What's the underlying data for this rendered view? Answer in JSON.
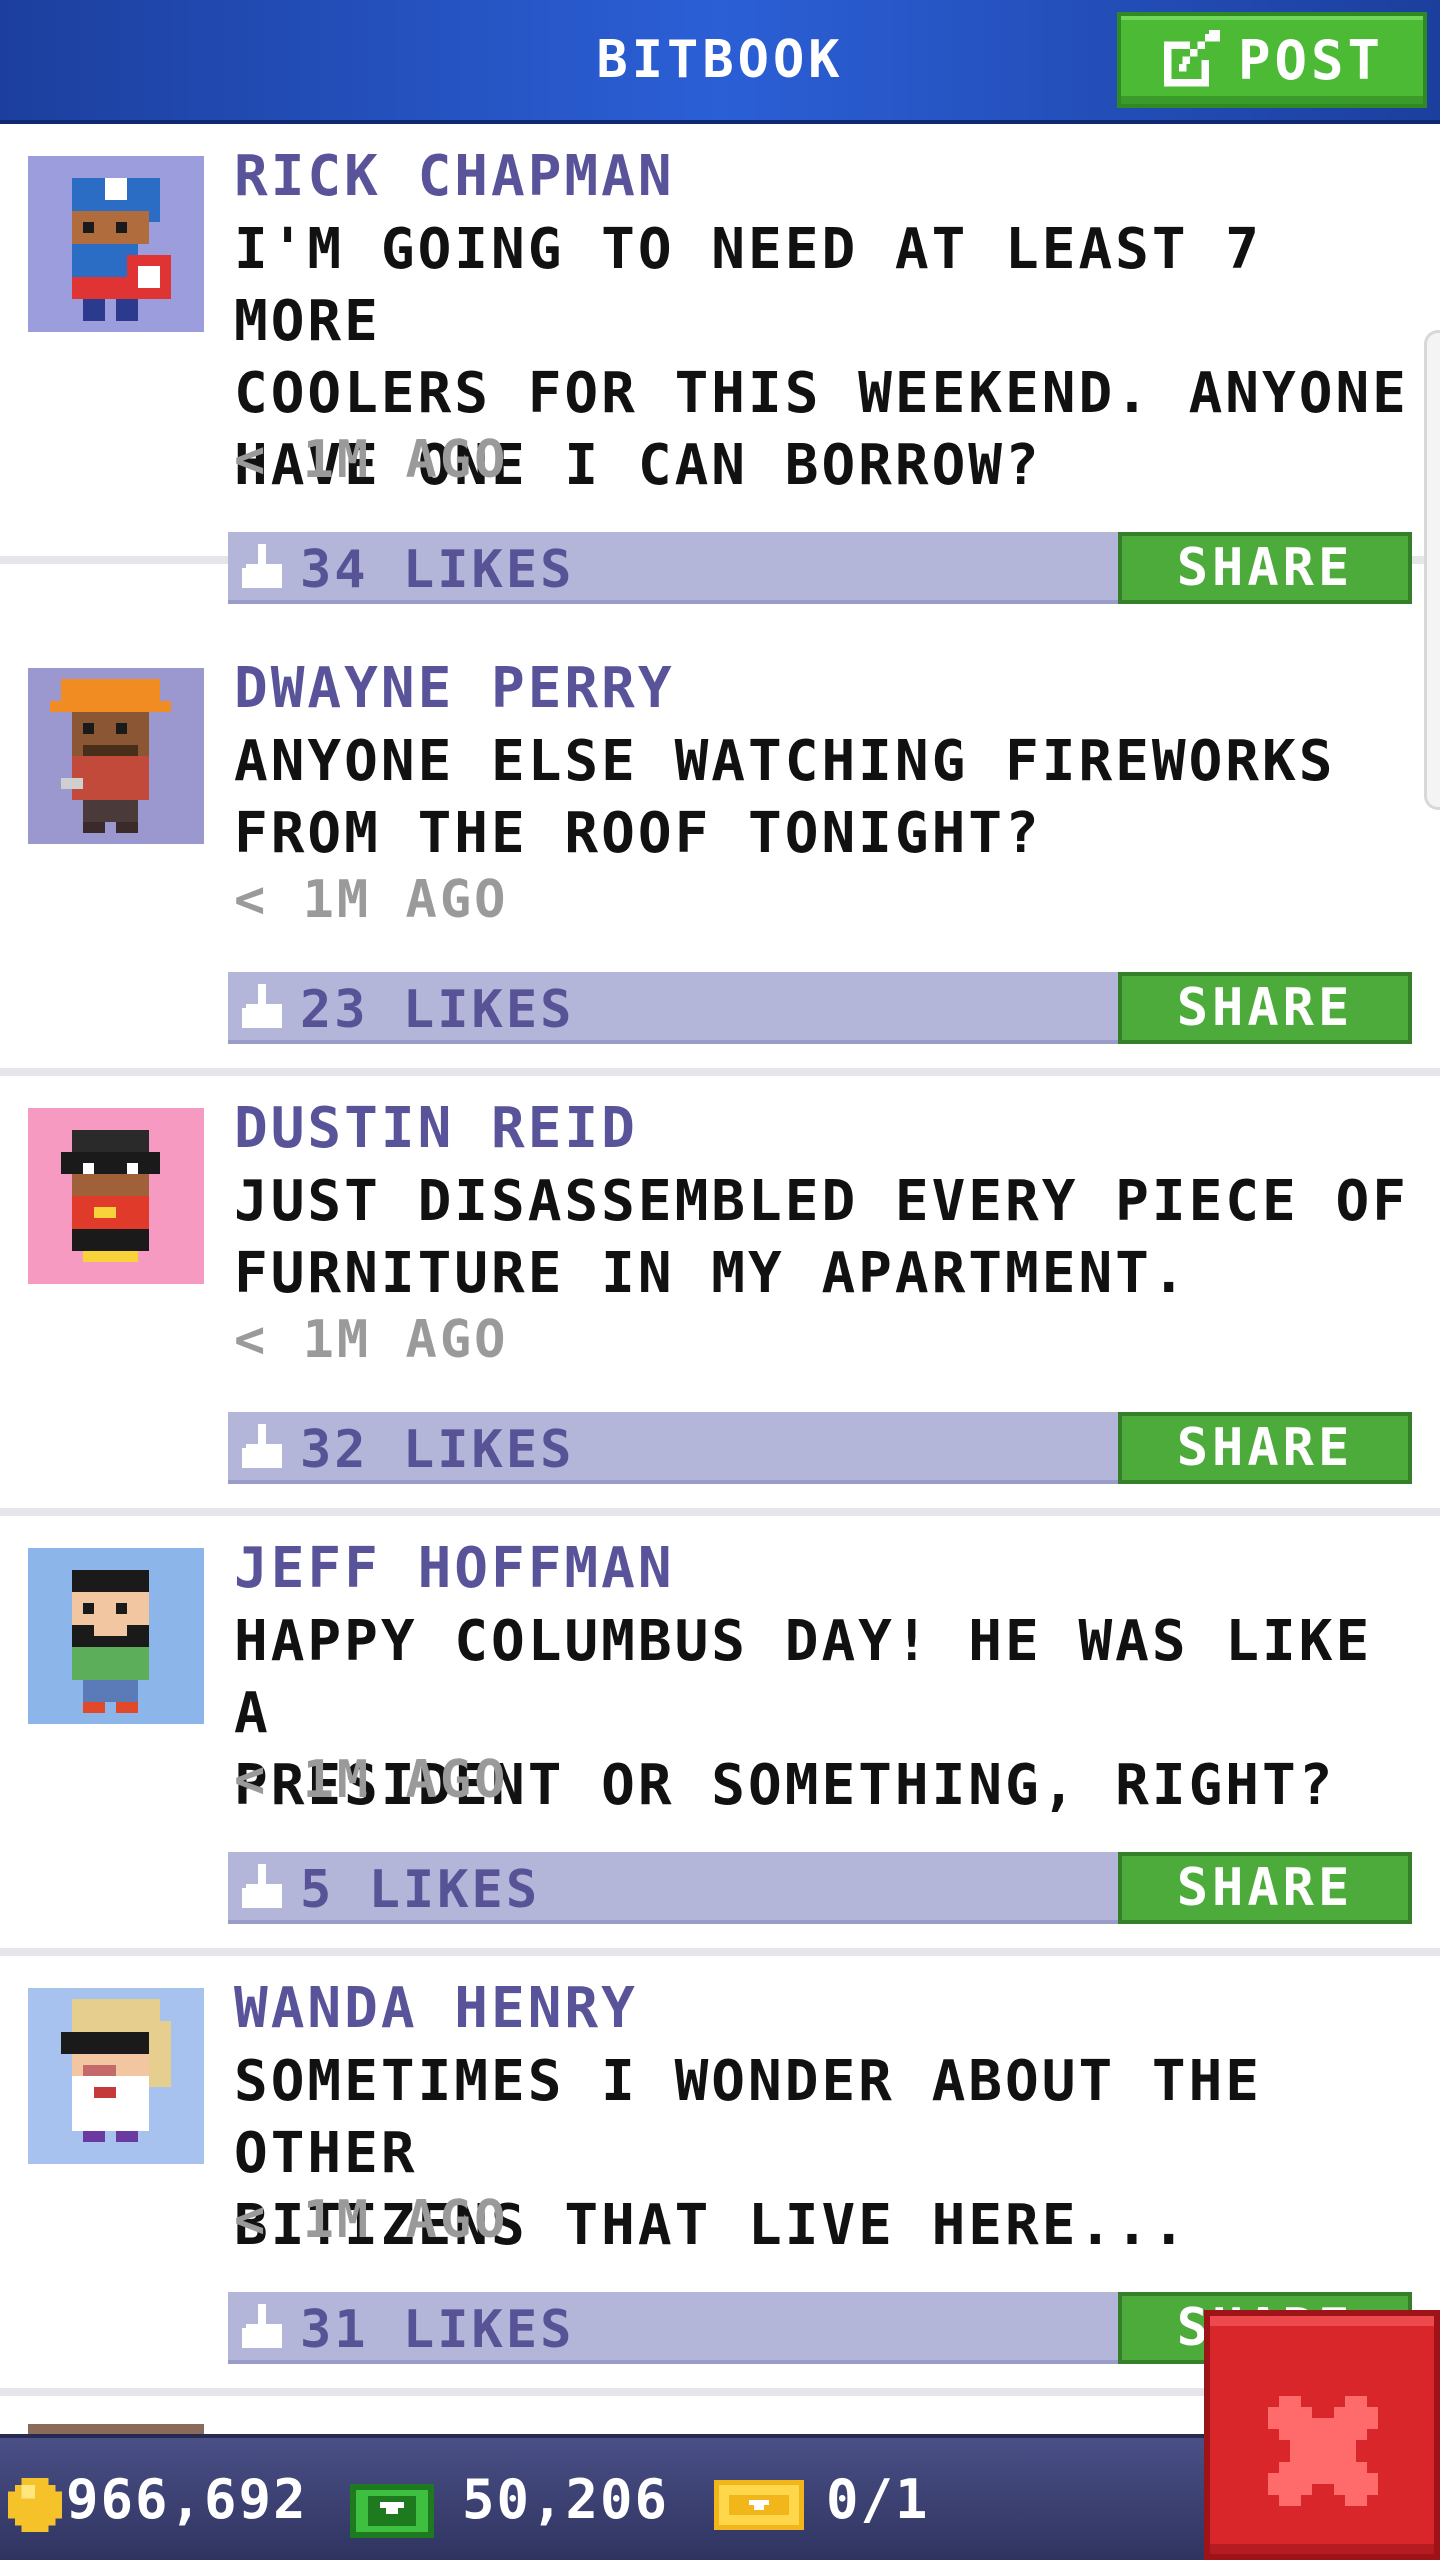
{
  "header": {
    "title": "BITBOOK",
    "post_label": "POST"
  },
  "posts": [
    {
      "author": "RICK CHAPMAN",
      "message": "I'M GOING TO NEED AT LEAST 7 MORE\nCOOLERS FOR THIS WEEKEND. ANYONE\nHAVE ONE I CAN BORROW?",
      "time": "< 1M AGO",
      "likes": "34 LIKES",
      "share": "SHARE",
      "avatar_bg": "#9b9ddd",
      "avatar": "captain-hero-avatar"
    },
    {
      "author": "DWAYNE PERRY",
      "message": "ANYONE ELSE WATCHING FIREWORKS\nFROM THE ROOF TONIGHT?",
      "time": "< 1M AGO",
      "likes": "23 LIKES",
      "share": "SHARE",
      "avatar_bg": "#9a98cf",
      "avatar": "construction-worker-avatar"
    },
    {
      "author": "DUSTIN REID",
      "message": "JUST DISASSEMBLED EVERY PIECE OF\nFURNITURE IN MY APARTMENT.",
      "time": "< 1M AGO",
      "likes": "32 LIKES",
      "share": "SHARE",
      "avatar_bg": "#f79ac2",
      "avatar": "masked-robber-avatar"
    },
    {
      "author": "JEFF HOFFMAN",
      "message": "HAPPY COLUMBUS DAY! HE WAS LIKE A\nPRESIDENT OR SOMETHING, RIGHT?",
      "time": "< 1M AGO",
      "likes": "5 LIKES",
      "share": "SHARE",
      "avatar_bg": "#8cb6ea",
      "avatar": "bearded-man-avatar"
    },
    {
      "author": "WANDA HENRY",
      "message": "SOMETIMES I WONDER ABOUT THE OTHER\nBITIZENS THAT LIVE HERE...",
      "time": "< 1M AGO",
      "likes": "31 LIKES",
      "share": "SHARE",
      "avatar_bg": "#a8c2f0",
      "avatar": "sunglasses-woman-avatar"
    }
  ],
  "footer": {
    "coins": "966,692",
    "bux": "50,206",
    "tickets": "0/1"
  },
  "colors": {
    "header_blue": "#2b5fd6",
    "button_green": "#4cab3a",
    "name_purple": "#595399",
    "like_bar": "#b3b5d9",
    "close_red": "#d8262b"
  }
}
